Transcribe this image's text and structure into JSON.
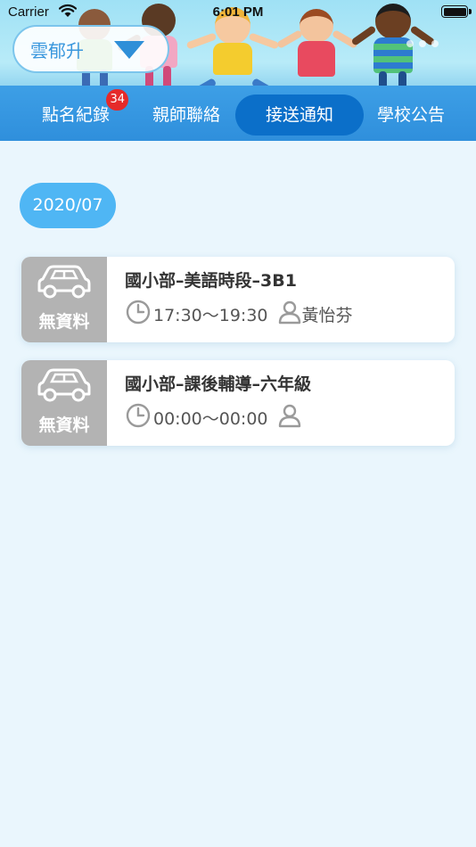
{
  "status_bar": {
    "carrier": "Carrier",
    "time": "6:01 PM"
  },
  "header": {
    "school_selector": "雲郁升"
  },
  "tabs": [
    {
      "label": "點名紀錄",
      "badge": "34"
    },
    {
      "label": "親師聯絡"
    },
    {
      "label": "接送通知",
      "active": true
    },
    {
      "label": "學校公告"
    }
  ],
  "date_chip": "2020/07",
  "records": [
    {
      "status": "無資料",
      "title": "國小部–美語時段–3B1",
      "time": "17:30～19:30",
      "teacher": "黃怡芬"
    },
    {
      "status": "無資料",
      "title": "國小部–課後輔導–六年級",
      "time": "00:00～00:00",
      "teacher": ""
    }
  ],
  "colors": {
    "tabbar": "#2f8fdc",
    "tab_active": "#0b6fc9",
    "badge": "#e52a2a",
    "date_chip": "#4fb6f4",
    "status_box": "#b3b3b3",
    "background": "#eaf6fd"
  },
  "icons": {
    "car": "car-icon",
    "clock": "clock-icon",
    "person": "person-icon",
    "dropdown": "triangle-down-icon",
    "wifi": "wifi-icon",
    "battery": "battery-icon"
  }
}
